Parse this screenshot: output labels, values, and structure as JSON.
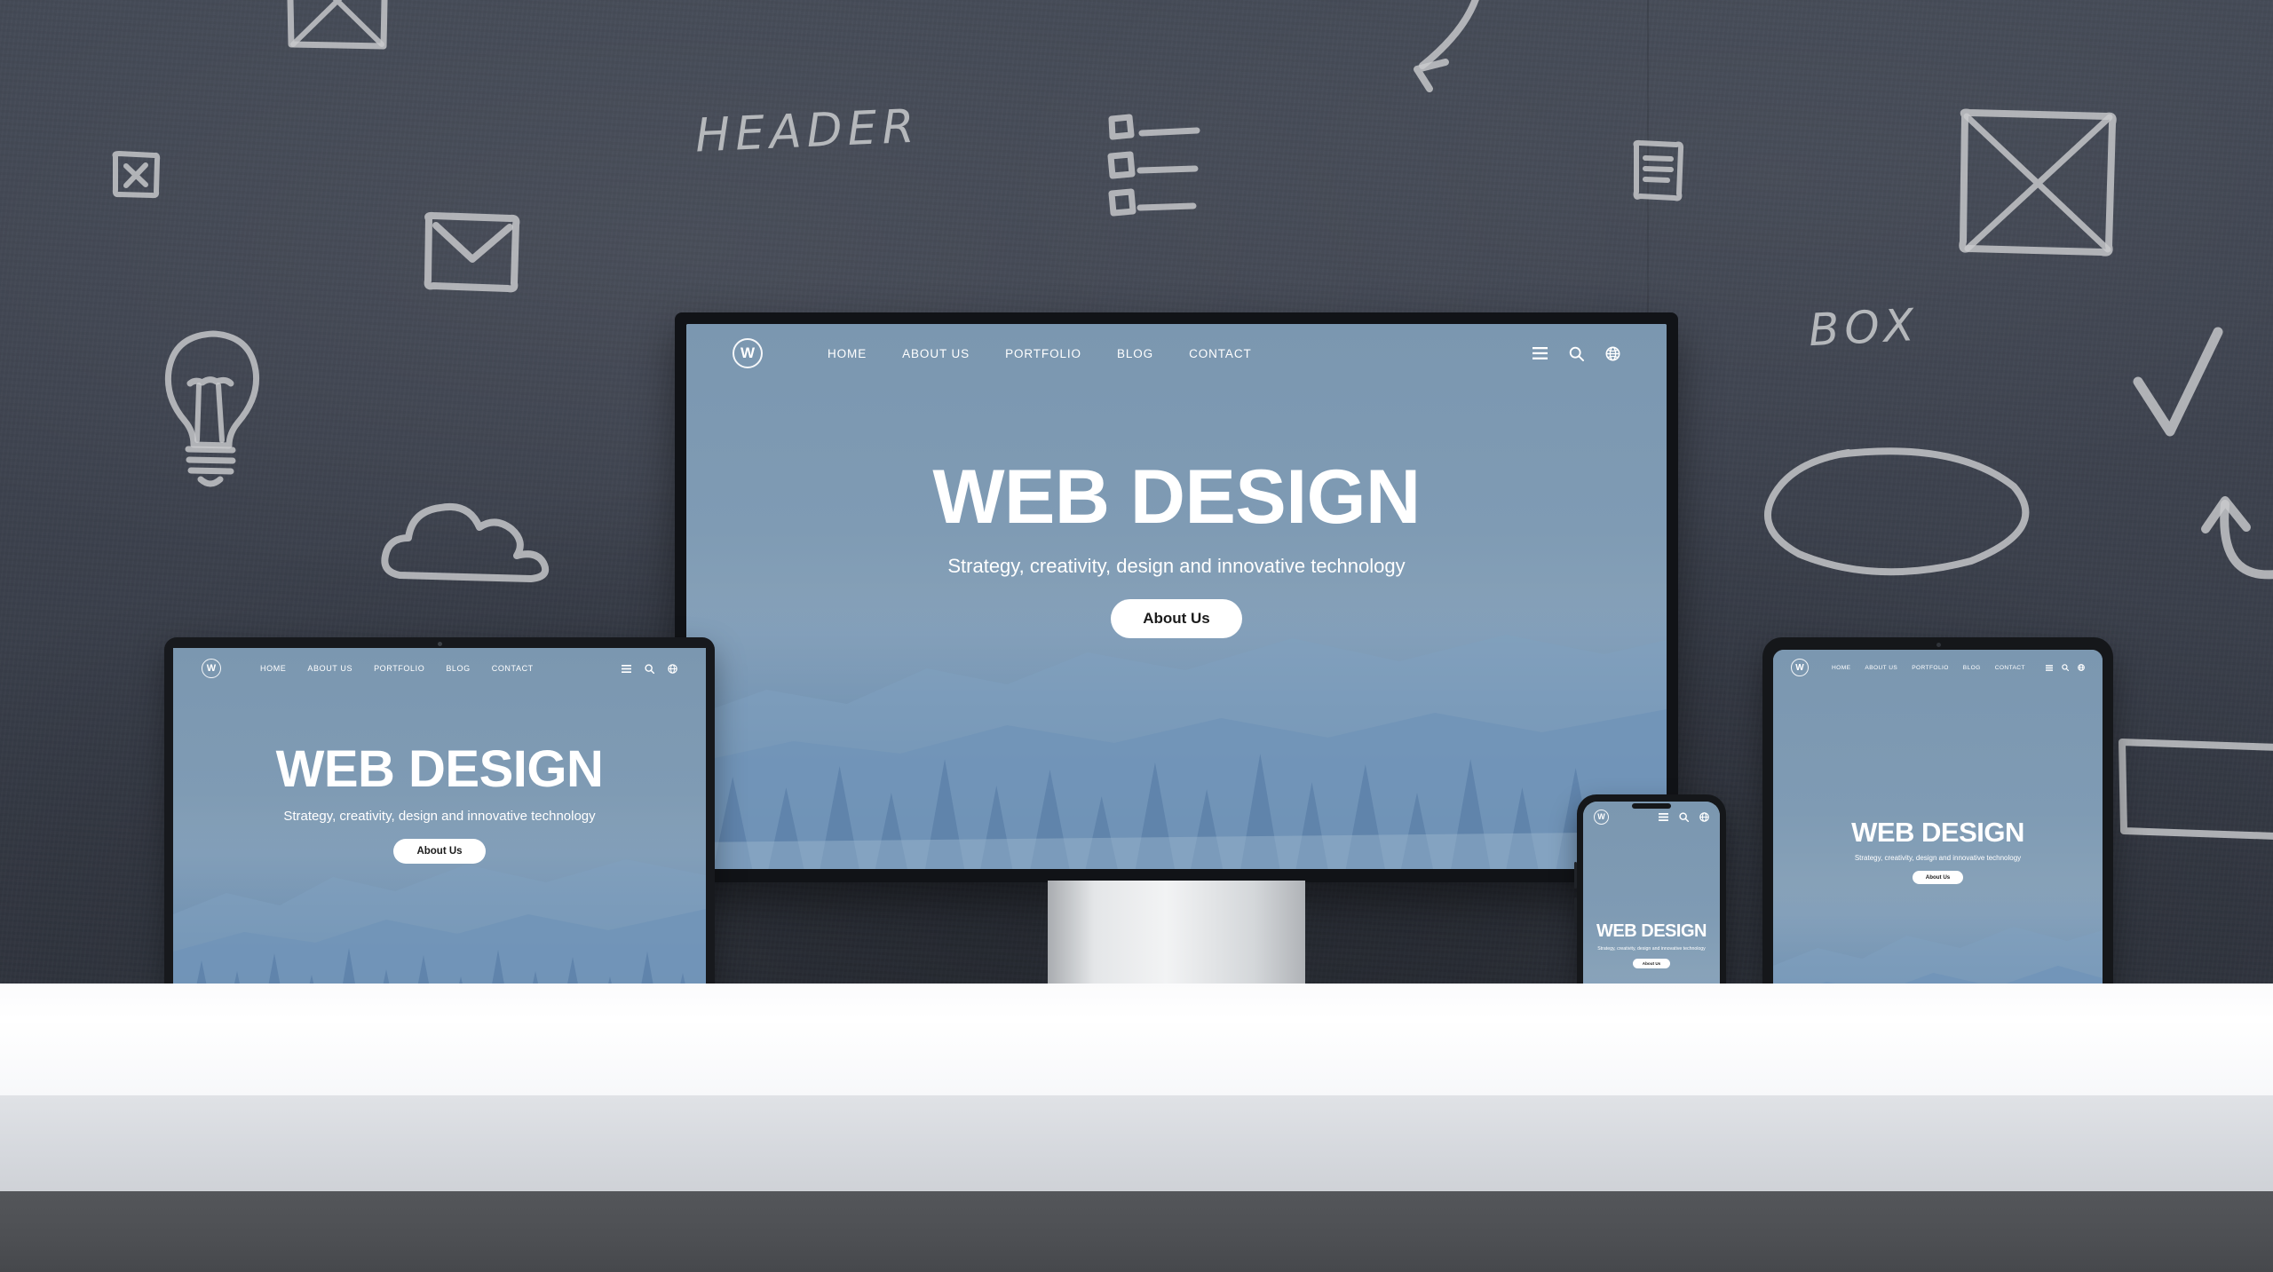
{
  "scene": {
    "title": "Responsive web design mockup on chalkboard wall",
    "wall_color": "#3f4450",
    "desk_color": "#ffffff",
    "floor_color": "#4d4f53"
  },
  "site": {
    "logo_letter": "W",
    "brand_color": "#7f9bb3",
    "nav_links": [
      "HOME",
      "ABOUT US",
      "PORTFOLIO",
      "BLOG",
      "CONTACT"
    ],
    "nav_icons": [
      "menu-icon",
      "search-icon",
      "globe-icon"
    ],
    "hero_title": "WEB DESIGN",
    "hero_subtitle": "Strategy, creativity, design and innovative technology",
    "hero_button": "About Us"
  },
  "devices": [
    {
      "name": "monitor",
      "label": "Desktop monitor"
    },
    {
      "name": "laptop",
      "label": "Laptop"
    },
    {
      "name": "phone",
      "label": "Smartphone"
    },
    {
      "name": "tablet",
      "label": "Tablet"
    }
  ],
  "sketches": {
    "chalk_color": "#c9cbcd",
    "texts": [
      {
        "name": "header-sketch-text",
        "text": "HEADER"
      },
      {
        "name": "box-sketch-text",
        "text": "BOX"
      }
    ],
    "icons": [
      "image-placeholder-sketch-top-left",
      "close-box-sketch",
      "envelope-sketch",
      "lightbulb-sketch",
      "cloud-sketch",
      "checklist-sketch",
      "curved-arrow-down-sketch",
      "document-sketch",
      "image-placeholder-sketch-top-right",
      "checkmark-sketch",
      "ellipse-sketch",
      "curved-arrow-up-sketch",
      "rectangle-sketch"
    ]
  }
}
